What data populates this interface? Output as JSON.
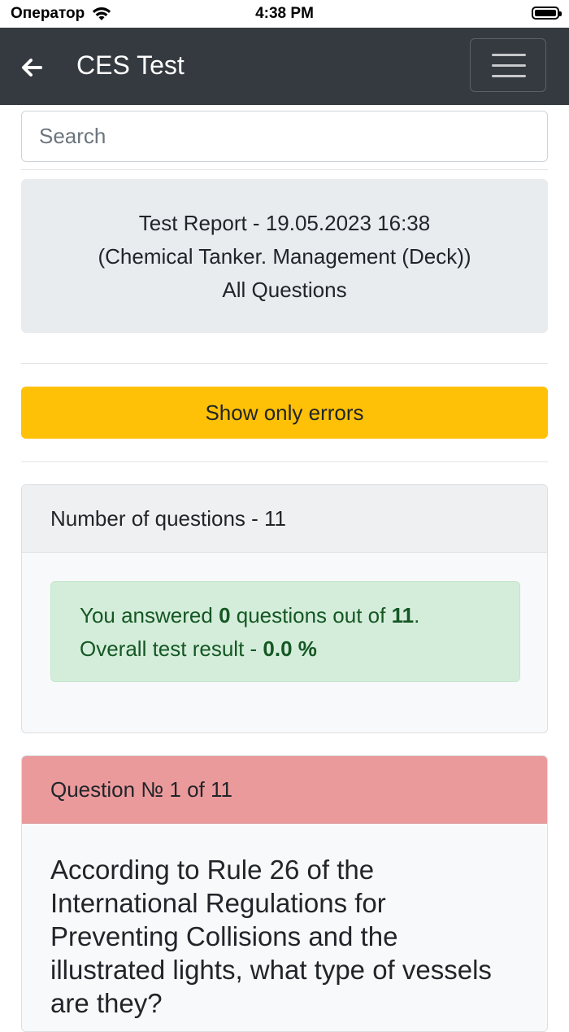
{
  "status_bar": {
    "carrier": "Оператор",
    "time": "4:38 PM"
  },
  "navbar": {
    "title": "CES Test",
    "back_icon": "arrow-left-icon",
    "menu_icon": "hamburger-icon"
  },
  "search": {
    "placeholder": "Search",
    "value": ""
  },
  "report": {
    "line1": "Test Report - 19.05.2023 16:38",
    "line2": "(Chemical Tanker. Management (Deck))",
    "line3": "All Questions"
  },
  "errors_button": {
    "label": "Show only errors",
    "color": "#ffc107"
  },
  "summary": {
    "header": "Number of questions - 11",
    "answered_prefix": "You answered ",
    "answered_count": "0",
    "answered_middle": " questions out of ",
    "total_count": "11",
    "answered_suffix": ".",
    "result_prefix": "Overall test result - ",
    "result_value": "0.0 %"
  },
  "question": {
    "header": "Question № 1 of 11",
    "header_color": "#eb9a9c",
    "text": "According to Rule 26 of the International Regulations for Preventing Collisions and the illustrated lights, what type of vessels are they?"
  }
}
